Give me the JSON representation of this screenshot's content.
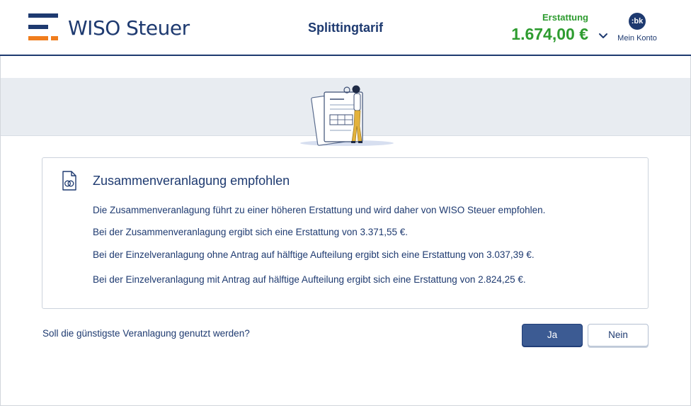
{
  "header": {
    "brand": "WISO Steuer",
    "page_title": "Splittingtarif",
    "refund_label": "Erstattung",
    "refund_value": "1.674,00 €",
    "account_initials": ":bk",
    "account_label": "Mein Konto"
  },
  "card": {
    "title": "Zusammenveranlagung empfohlen",
    "lines": [
      "Die Zusammenveranlagung führt zu einer höheren Erstattung und wird daher von WISO Steuer empfohlen.",
      "Bei der Zusammenveranlagung ergibt sich eine Erstattung von 3.371,55 €.",
      "Bei der Einzelveranlagung ohne Antrag auf hälftige Aufteilung ergibt sich eine Erstattung von 3.037,39 €.",
      "Bei der Einzelveranlagung mit Antrag auf hälftige Aufteilung ergibt sich eine Erstattung von 2.824,25 €."
    ]
  },
  "question": "Soll die günstigste Veranlagung genutzt werden?",
  "buttons": {
    "yes": "Ja",
    "no": "Nein"
  },
  "colors": {
    "brand": "#1e3a70",
    "accent": "#f07d1d",
    "refund": "#2e9c30",
    "primary_button": "#3c5b93"
  },
  "icons": {
    "card": "document-rings-icon",
    "dropdown": "chevron-down-icon"
  }
}
